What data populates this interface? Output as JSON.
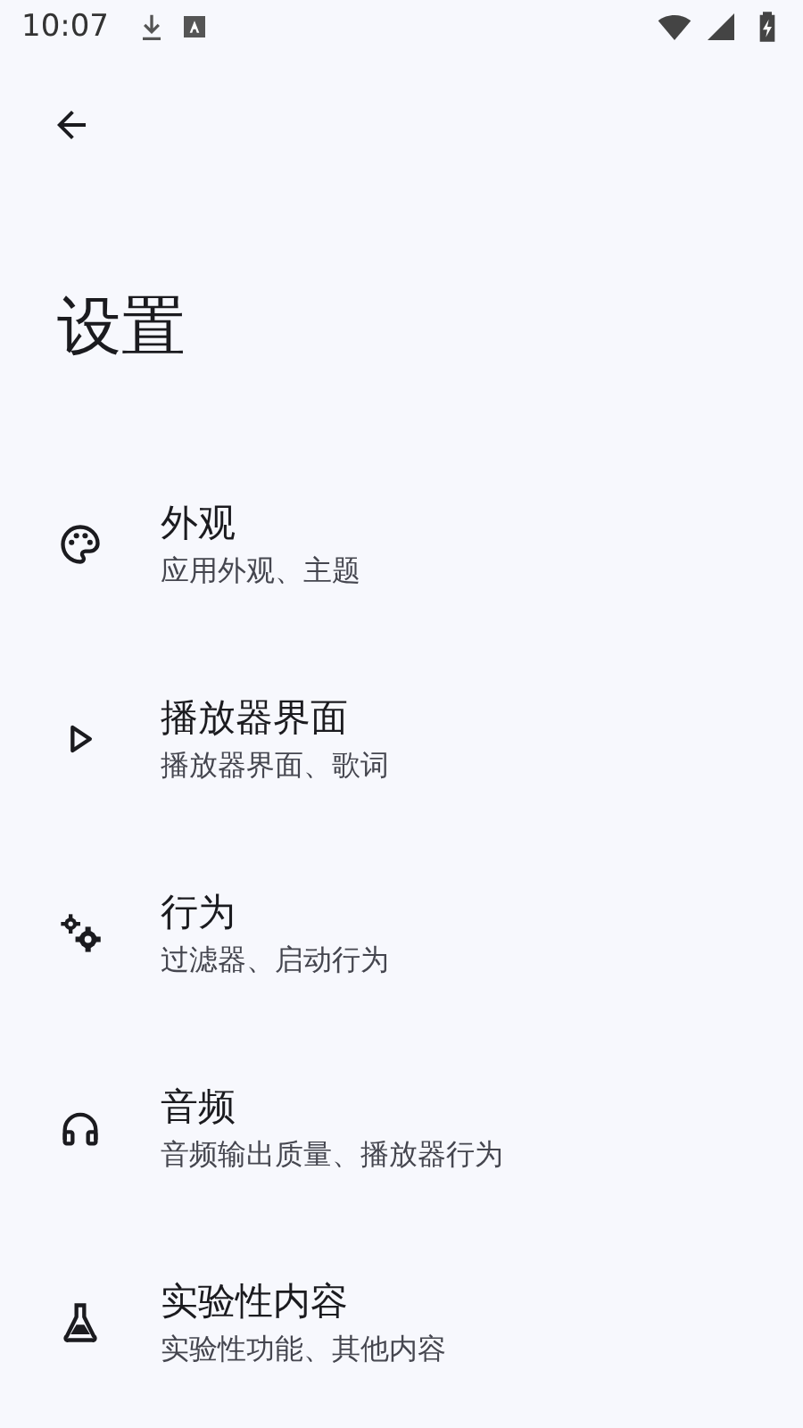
{
  "status_bar": {
    "time": "10:07"
  },
  "title": "设置",
  "items": [
    {
      "title": "外观",
      "subtitle": "应用外观、主题"
    },
    {
      "title": "播放器界面",
      "subtitle": "播放器界面、歌词"
    },
    {
      "title": "行为",
      "subtitle": "过滤器、启动行为"
    },
    {
      "title": "音频",
      "subtitle": "音频输出质量、播放器行为"
    },
    {
      "title": "实验性内容",
      "subtitle": "实验性功能、其他内容"
    }
  ]
}
